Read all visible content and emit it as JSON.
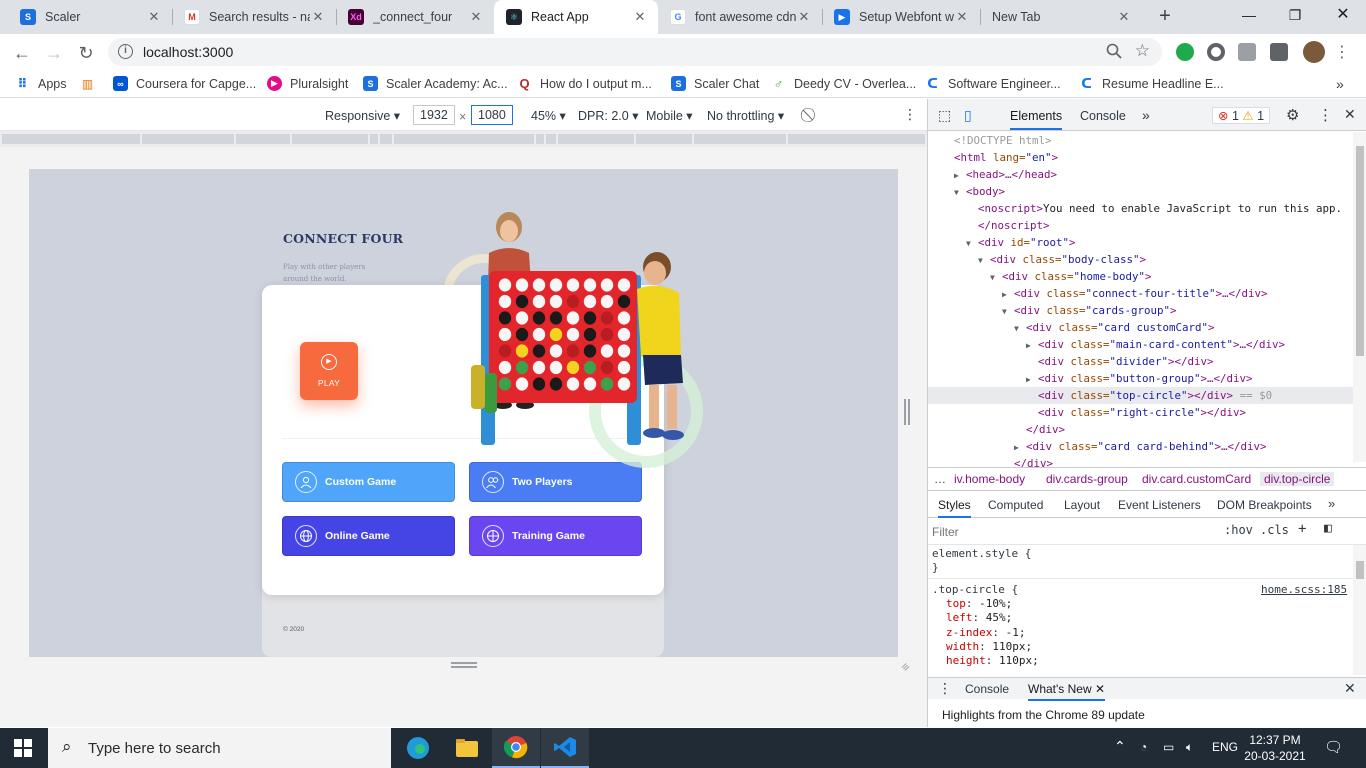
{
  "browser": {
    "tabs": [
      {
        "title": "Scaler",
        "icon": "scaler-icon"
      },
      {
        "title": "Search results - na",
        "icon": "gmail-icon"
      },
      {
        "title": "_connect_four",
        "icon": "adobe-xd-icon"
      },
      {
        "title": "React App",
        "icon": "react-icon"
      },
      {
        "title": "font awesome cdn",
        "icon": "google-icon"
      },
      {
        "title": "Setup Webfont wi",
        "icon": "setup-icon"
      },
      {
        "title": "New Tab",
        "icon": ""
      }
    ],
    "url": "localhost:3000",
    "bookmarks": [
      {
        "label": "Apps"
      },
      {
        "label": ""
      },
      {
        "label": "Coursera for Capge..."
      },
      {
        "label": "Pluralsight"
      },
      {
        "label": "Scaler Academy: Ac..."
      },
      {
        "label": "How do I output m..."
      },
      {
        "label": "Scaler Chat"
      },
      {
        "label": "Deedy CV - Overlea..."
      },
      {
        "label": "Software Engineer..."
      },
      {
        "label": "Resume Headline E..."
      }
    ]
  },
  "device_toolbar": {
    "mode": "Responsive",
    "width": "1932",
    "height": "1080",
    "zoom": "45%",
    "dpr": "DPR: 2.0",
    "device_type": "Mobile",
    "throttling": "No throttling"
  },
  "app": {
    "title": "CONNECT FOUR",
    "subtitle": "Play with other players around the world.",
    "play_label": "PLAY",
    "buttons": [
      {
        "label": "Custom Game",
        "color": "#4fa5fa"
      },
      {
        "label": "Two Players",
        "color": "#4a7cf3"
      },
      {
        "label": "Online Game",
        "color": "#4545e6"
      },
      {
        "label": "Training Game",
        "color": "#6a46f0"
      }
    ],
    "copyright": "© 2020",
    "play_color": "#f66a3e",
    "background": "#ced2dd"
  },
  "devtools": {
    "tabs": [
      "Elements",
      "Console"
    ],
    "errors": "1",
    "warnings": "1",
    "dom": [
      {
        "text": "<!DOCTYPE html>"
      },
      {
        "tag_open": "<html",
        "attr": " lang=",
        "val": "\"en\"",
        "close": ">"
      },
      {
        "text": "<head>…</head>"
      },
      {
        "text": "<body>"
      },
      {
        "tag_open": "<noscript>",
        "inner": "You need to enable JavaScript to run this app."
      },
      {
        "text": "</noscript>"
      },
      {
        "tag_open": "<div",
        "attr": " id=",
        "val": "\"root\"",
        "close": ">"
      },
      {
        "tag_open": "<div",
        "attr": " class=",
        "val": "\"body-class\"",
        "close": ">"
      },
      {
        "tag_open": "<div",
        "attr": " class=",
        "val": "\"home-body\"",
        "close": ">"
      },
      {
        "tag_open": "<div",
        "attr": " class=",
        "val": "\"connect-four-title\"",
        "close": ">…</div>"
      },
      {
        "tag_open": "<div",
        "attr": " class=",
        "val": "\"cards-group\"",
        "close": ">"
      },
      {
        "tag_open": "<div",
        "attr": " class=",
        "val": "\"card customCard\"",
        "close": ">"
      },
      {
        "tag_open": "<div",
        "attr": " class=",
        "val": "\"main-card-content\"",
        "close": ">…</div>"
      },
      {
        "tag_open": "<div",
        "attr": " class=",
        "val": "\"divider\"",
        "close": "></div>"
      },
      {
        "tag_open": "<div",
        "attr": " class=",
        "val": "\"button-group\"",
        "close": ">…</div>"
      },
      {
        "tag_open": "<div",
        "attr": " class=",
        "val": "\"top-circle\"",
        "close": "></div>",
        "suffix": " == $0"
      },
      {
        "tag_open": "<div",
        "attr": " class=",
        "val": "\"right-circle\"",
        "close": "></div>"
      },
      {
        "text": "</div>"
      },
      {
        "tag_open": "<div",
        "attr": " class=",
        "val": "\"card card-behind\"",
        "close": ">…</div>"
      },
      {
        "text": "</div>"
      }
    ],
    "breadcrumbs": [
      "iv.home-body",
      "div.cards-group",
      "div.card.customCard",
      "div.top-circle"
    ],
    "style_tabs": [
      "Styles",
      "Computed",
      "Layout",
      "Event Listeners",
      "DOM Breakpoints"
    ],
    "filter_placeholder": "Filter",
    "filter_tools": [
      ":hov",
      ".cls",
      "+"
    ],
    "element_style": "element.style {",
    "element_style_close": "}",
    "rule_selector": ".top-circle {",
    "rule_source": "home.scss:185",
    "rule_props": [
      {
        "name": "top",
        "value": "-10%;"
      },
      {
        "name": "left",
        "value": "45%;"
      },
      {
        "name": "z-index",
        "value": "-1;"
      },
      {
        "name": "width",
        "value": "110px;"
      },
      {
        "name": "height",
        "value": "110px;"
      }
    ],
    "drawer_tabs": [
      "Console",
      "What's New"
    ],
    "highlights": "Highlights from the Chrome 89 update"
  },
  "taskbar": {
    "search_placeholder": "Type here to search",
    "language": "ENG",
    "time": "12:37 PM",
    "date": "20-03-2021"
  }
}
